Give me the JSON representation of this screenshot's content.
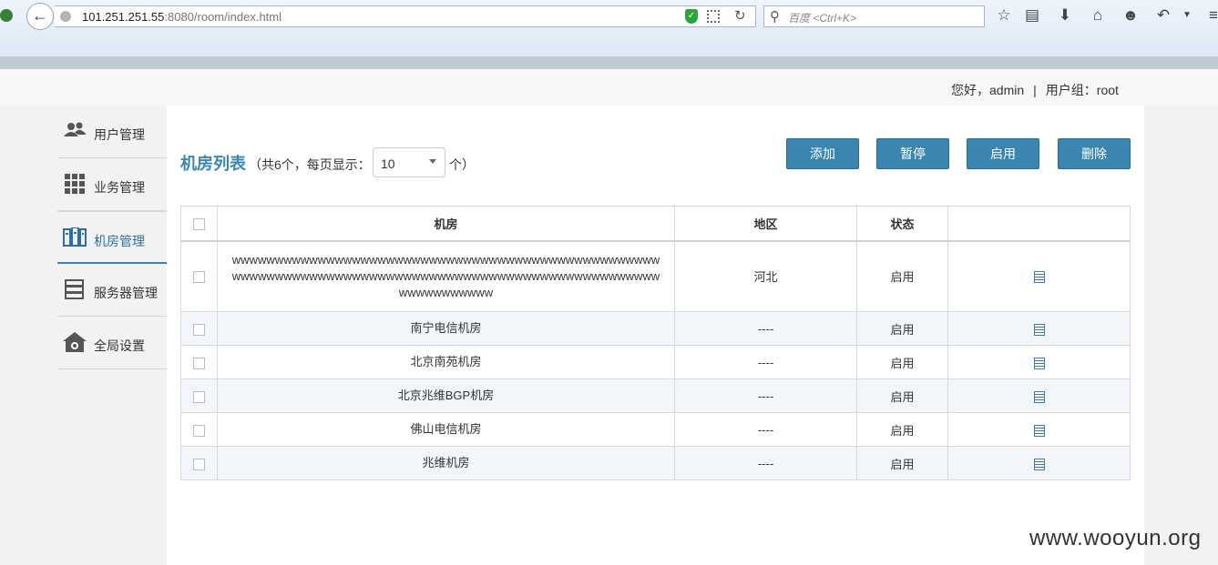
{
  "browser": {
    "url_host": "101.251.251.55",
    "url_rest": ":8080/room/index.html",
    "search_placeholder": "百度 <Ctrl+K>"
  },
  "header": {
    "greeting": "您好，admin",
    "separator": "|",
    "group": "用户组：root"
  },
  "sidebar": {
    "items": [
      {
        "label": "用户管理",
        "icon": "users-icon"
      },
      {
        "label": "业务管理",
        "icon": "grid-icon"
      },
      {
        "label": "机房管理",
        "icon": "server-room-icon",
        "active": true
      },
      {
        "label": "服务器管理",
        "icon": "server-icon"
      },
      {
        "label": "全局设置",
        "icon": "settings-icon"
      }
    ]
  },
  "main": {
    "title": "机房列表",
    "meta_prefix": "（共6个，每页显示：",
    "page_size": "10",
    "meta_suffix": "个）",
    "buttons": {
      "add": "添加",
      "pause": "暂停",
      "enable": "启用",
      "delete": "删除"
    },
    "table": {
      "headers": {
        "room": "机房",
        "region": "地区",
        "status": "状态",
        "actions": ""
      },
      "rows": [
        {
          "room": "wwwwwwwwwwwwwwwwwwwwwwwwwwwwwwwwwwwwwwwwwwwwwwwwwwwwwwwwwwwwwwwwwwwwwwwwwwwwwwwwwwwwwwwwwwwwwwwwwwwwwwwwwwwwwww",
          "region": "河北",
          "status": "启用"
        },
        {
          "room": "南宁电信机房",
          "region": "----",
          "status": "启用"
        },
        {
          "room": "北京南苑机房",
          "region": "----",
          "status": "启用"
        },
        {
          "room": "北京兆维BGP机房",
          "region": "----",
          "status": "启用"
        },
        {
          "room": "佛山电信机房",
          "region": "----",
          "status": "启用"
        },
        {
          "room": "兆维机房",
          "region": "----",
          "status": "启用"
        }
      ]
    }
  },
  "watermark": "www.wooyun.org"
}
